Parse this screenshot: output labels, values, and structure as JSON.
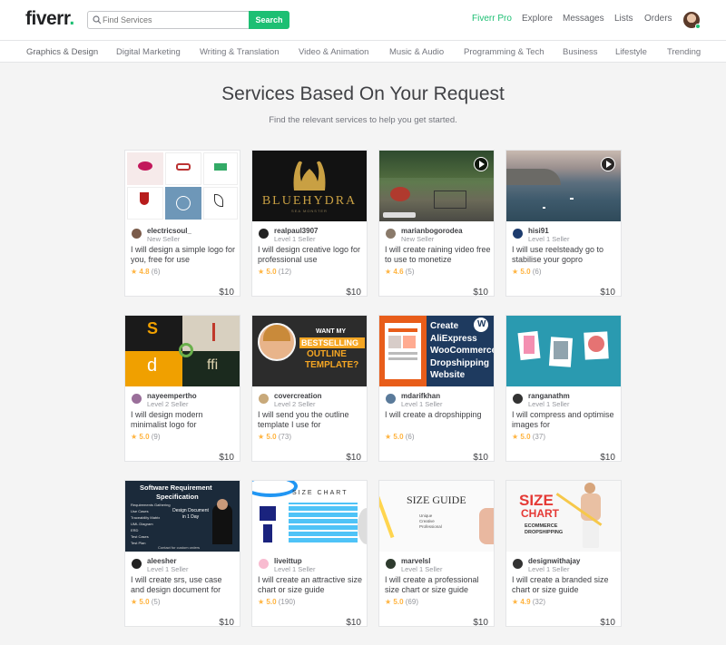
{
  "header": {
    "logo": "fiverr",
    "logo_dot": ".",
    "search_placeholder": "Find Services",
    "search_button": "Search",
    "nav": {
      "pro": "Fiverr Pro",
      "explore": "Explore",
      "messages": "Messages",
      "lists": "Lists",
      "orders": "Orders"
    }
  },
  "categories": [
    "Graphics & Design",
    "Digital Marketing",
    "Writing & Translation",
    "Video & Animation",
    "Music & Audio",
    "Programming & Tech",
    "Business",
    "Lifestyle",
    "Trending"
  ],
  "main": {
    "title": "Services Based On Your Request",
    "subtitle": "Find the relevant services to help you get started."
  },
  "cards": [
    {
      "seller": "electricsoul_",
      "level": "New Seller",
      "title": "I will design a simple logo for you, free for use",
      "score": "4.8",
      "count": "(6)",
      "price": "$10"
    },
    {
      "seller": "realpaul3907",
      "level": "Level 1 Seller",
      "title": "I will design creative logo for professional use",
      "score": "5.0",
      "count": "(12)",
      "price": "$10"
    },
    {
      "seller": "marianbogorodea",
      "level": "New Seller",
      "title": "I will create raining video free to use to monetize",
      "score": "4.6",
      "count": "(5)",
      "price": "$10"
    },
    {
      "seller": "hisi91",
      "level": "Level 1 Seller",
      "title": "I will use reelsteady go to stabilise your gopro",
      "score": "5.0",
      "count": "(6)",
      "price": "$10"
    },
    {
      "seller": "nayeempertho",
      "level": "Level 2 Seller",
      "title": "I will design modern minimalist logo for",
      "score": "5.0",
      "count": "(9)",
      "price": "$10"
    },
    {
      "seller": "covercreation",
      "level": "Level 2 Seller",
      "title": "I will send you the outline template I use for",
      "score": "5.0",
      "count": "(73)",
      "price": "$10"
    },
    {
      "seller": "mdarifkhan",
      "level": "Level 1 Seller",
      "title": "I will create a dropshipping",
      "score": "5.0",
      "count": "(6)",
      "price": "$10"
    },
    {
      "seller": "ranganathm",
      "level": "Level 1 Seller",
      "title": "I will compress and optimise images for",
      "score": "5.0",
      "count": "(37)",
      "price": "$10"
    },
    {
      "seller": "aleesher",
      "level": "Level 1 Seller",
      "title": "I will create srs, use case and design document for",
      "score": "5.0",
      "count": "(5)",
      "price": "$10"
    },
    {
      "seller": "liveittup",
      "level": "Level 1 Seller",
      "title": "I will create an attractive size chart or size guide",
      "score": "5.0",
      "count": "(190)",
      "price": "$10"
    },
    {
      "seller": "marvelsl",
      "level": "Level 1 Seller",
      "title": "I will create a professional size chart or size guide",
      "score": "5.0",
      "count": "(69)",
      "price": "$10"
    },
    {
      "seller": "designwithajay",
      "level": "Level 1 Seller",
      "title": "I will create a branded size chart or size guide",
      "score": "4.9",
      "count": "(32)",
      "price": "$10"
    }
  ],
  "thumbs": {
    "bluehydra": "BLUEHYDRA",
    "bluehydra_sub": "SEA MONSTER",
    "outline_small": "WANT MY",
    "outline_1": "BESTSELLING",
    "outline_2": "OUTLINE",
    "outline_3": "TEMPLATE?",
    "drop_1": "Create",
    "drop_2": "AliExpress",
    "drop_3": "WooCommerce",
    "drop_4": "Dropshipping",
    "drop_5": "Website",
    "srs_1": "Software Requirement",
    "srs_2": "Specification",
    "srs_items": [
      "Requirements Gathering",
      "Use Cases",
      "Traceability Matrix",
      "UML Diagram",
      "ERD",
      "Test Cases",
      "Test Plan"
    ],
    "srs_doc": "Design Document in 1 Day",
    "srs_contact": "Contact for custom orders",
    "sizechart": "SIZE CHART",
    "sizeguide": "SIZE GUIDE",
    "sizeguide_items": [
      "Unique",
      "Creative",
      "Professional"
    ],
    "branded_1": "SIZE",
    "branded_2": "CHART",
    "branded_3": "ECOMMERCE",
    "branded_4": "DROPSHIPPING"
  },
  "colors": {
    "brand_green": "#1dbf73",
    "star": "#ffb33e",
    "text": "#404145",
    "muted": "#74767e"
  },
  "icons": {
    "search": "magnifier-icon",
    "play": "play-icon",
    "star": "star-icon"
  }
}
